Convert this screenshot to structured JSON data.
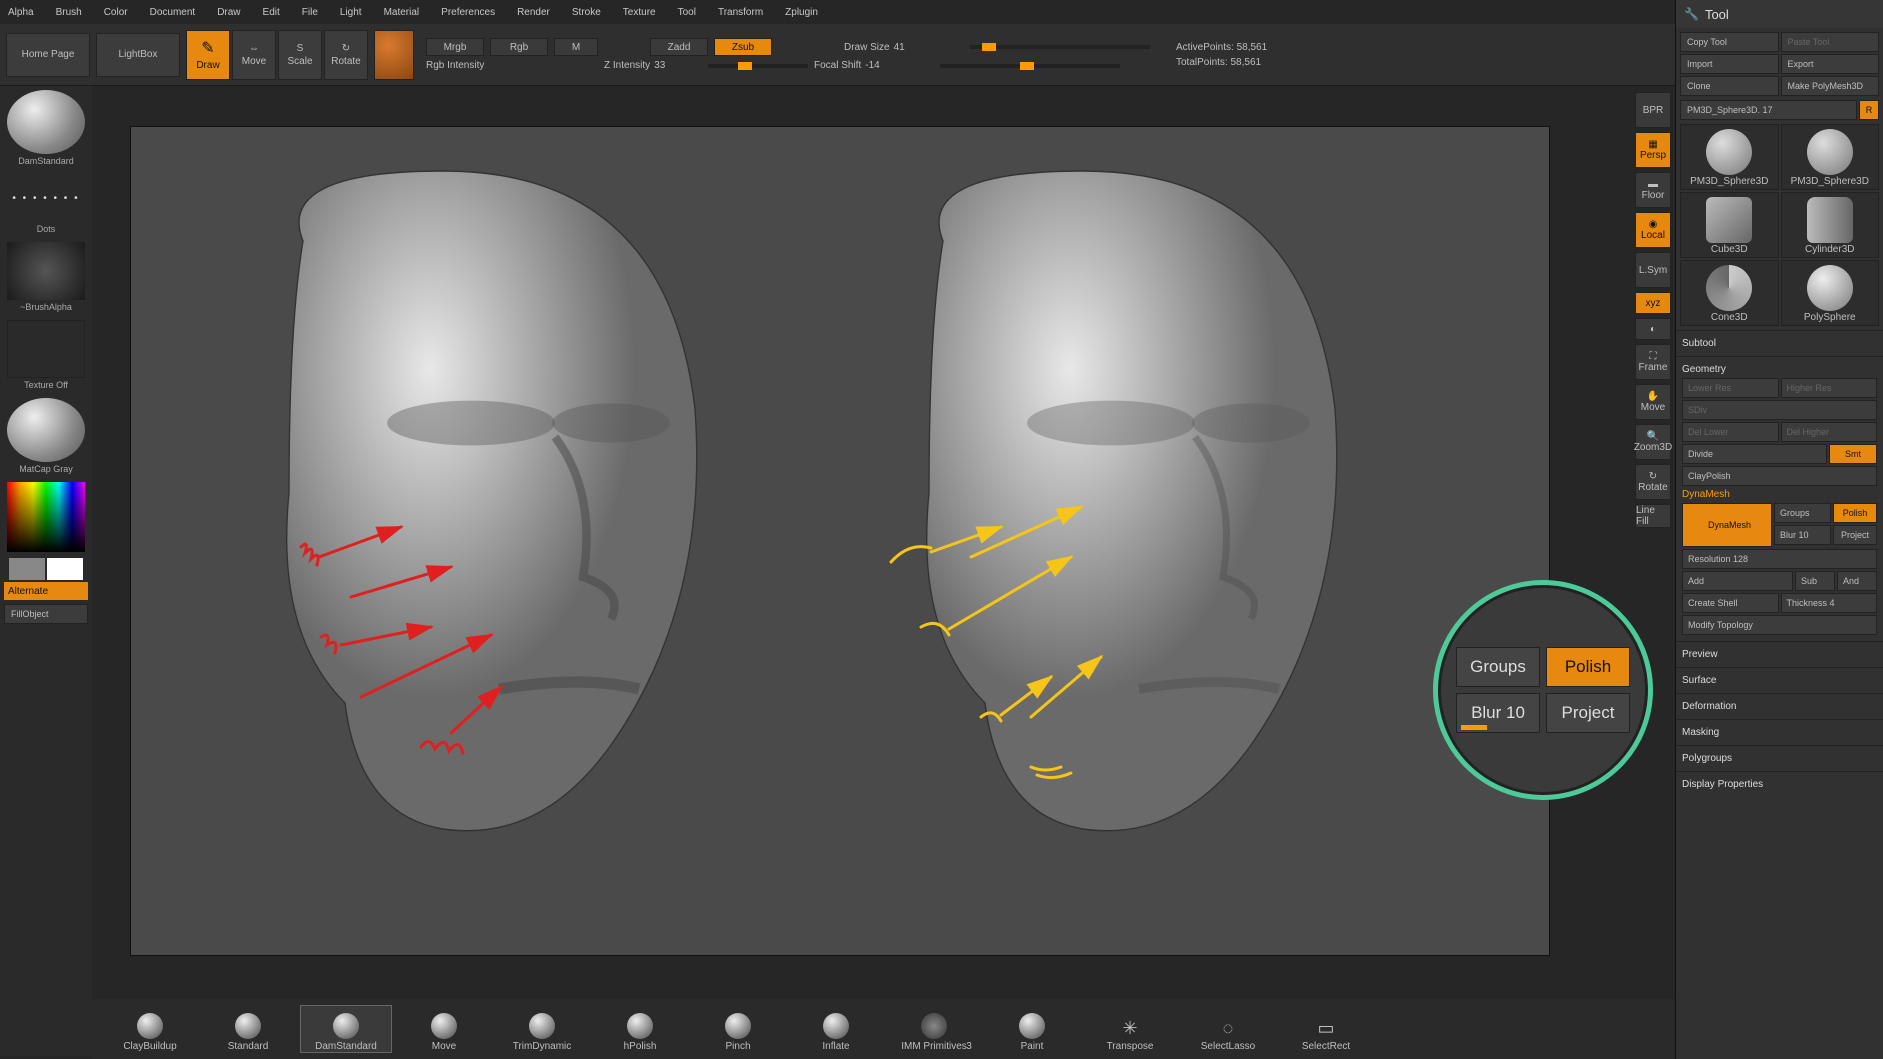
{
  "menu": [
    "Alpha",
    "Brush",
    "Color",
    "Document",
    "Draw",
    "Edit",
    "File",
    "Light",
    "Material",
    "Preferences",
    "Render",
    "Stroke",
    "Texture",
    "Tool",
    "Transform",
    "Zplugin"
  ],
  "toolbar": {
    "home": "Home Page",
    "lightbox": "LightBox",
    "draw": "Draw",
    "move": "Move",
    "scale": "Scale",
    "rotate": "Rotate",
    "modes": [
      "Mrgb",
      "Rgb",
      "M"
    ],
    "zmodes": [
      "Zadd",
      "Zsub"
    ],
    "rgb_intensity_label": "Rgb Intensity",
    "zintensity_label": "Z Intensity",
    "zintensity_val": "33",
    "drawsize_label": "Draw Size",
    "drawsize_val": "41",
    "focal_label": "Focal Shift",
    "focal_val": "-14",
    "active_label": "ActivePoints:",
    "active_val": "58,561",
    "total_label": "TotalPoints:",
    "total_val": "58,561"
  },
  "left": {
    "brush": "DamStandard",
    "stroke": "Dots",
    "alpha": "~BrushAlpha",
    "texture": "Texture Off",
    "material": "MatCap Gray",
    "alternate": "Alternate",
    "fill": "FillObject"
  },
  "rnav": [
    "BPR",
    "Persp",
    "Floor",
    "Local",
    "L.Sym",
    "xyz",
    "",
    "Frame",
    "Move",
    "Zoom3D",
    "Rotate",
    "Line Fill"
  ],
  "rnav_on": [
    false,
    true,
    false,
    true,
    false,
    true,
    false,
    false,
    false,
    false,
    false,
    false
  ],
  "tool": {
    "title": "Tool",
    "copy": "Copy Tool",
    "paste": "Paste Tool",
    "import": "Import",
    "export": "Export",
    "clone": "Clone",
    "make": "Make PolyMesh3D",
    "name": "PM3D_Sphere3D. 17",
    "R": "R",
    "items": [
      "PM3D_Sphere3D",
      "PM3D_Sphere3D",
      "Cube3D",
      "Cylinder3D",
      "Cone3D",
      "PolySphere"
    ],
    "sections": [
      "Subtool",
      "Geometry"
    ],
    "geom": {
      "lower": "Lower Res",
      "higher": "Higher Res",
      "sdiv": "SDiv",
      "dellow": "Del Lower",
      "delhigh": "Del Higher",
      "divide": "Divide",
      "smt": "Smt",
      "clay": "ClayPolish"
    },
    "dyn": {
      "h": "DynaMesh",
      "btn": "DynaMesh",
      "groups": "Groups",
      "polish": "Polish",
      "blur": "Blur 10",
      "project": "Project",
      "res": "Resolution 128",
      "add": "Add",
      "sub": "Sub",
      "and": "And",
      "shell": "Create Shell",
      "thick": "Thickness 4",
      "modtop": "Modify Topology"
    },
    "rest": [
      "Preview",
      "Surface",
      "Deformation",
      "Masking",
      "Polygroups",
      "Display Properties"
    ]
  },
  "shelf": [
    "ClayBuildup",
    "Standard",
    "DamStandard",
    "Move",
    "TrimDynamic",
    "hPolish",
    "Pinch",
    "Inflate",
    "IMM Primitives",
    "Paint",
    "Transpose",
    "SelectLasso",
    "SelectRect"
  ],
  "shelf_sel": 2,
  "callout": {
    "groups": "Groups",
    "polish": "Polish",
    "blur": "Blur 10",
    "project": "Project"
  }
}
